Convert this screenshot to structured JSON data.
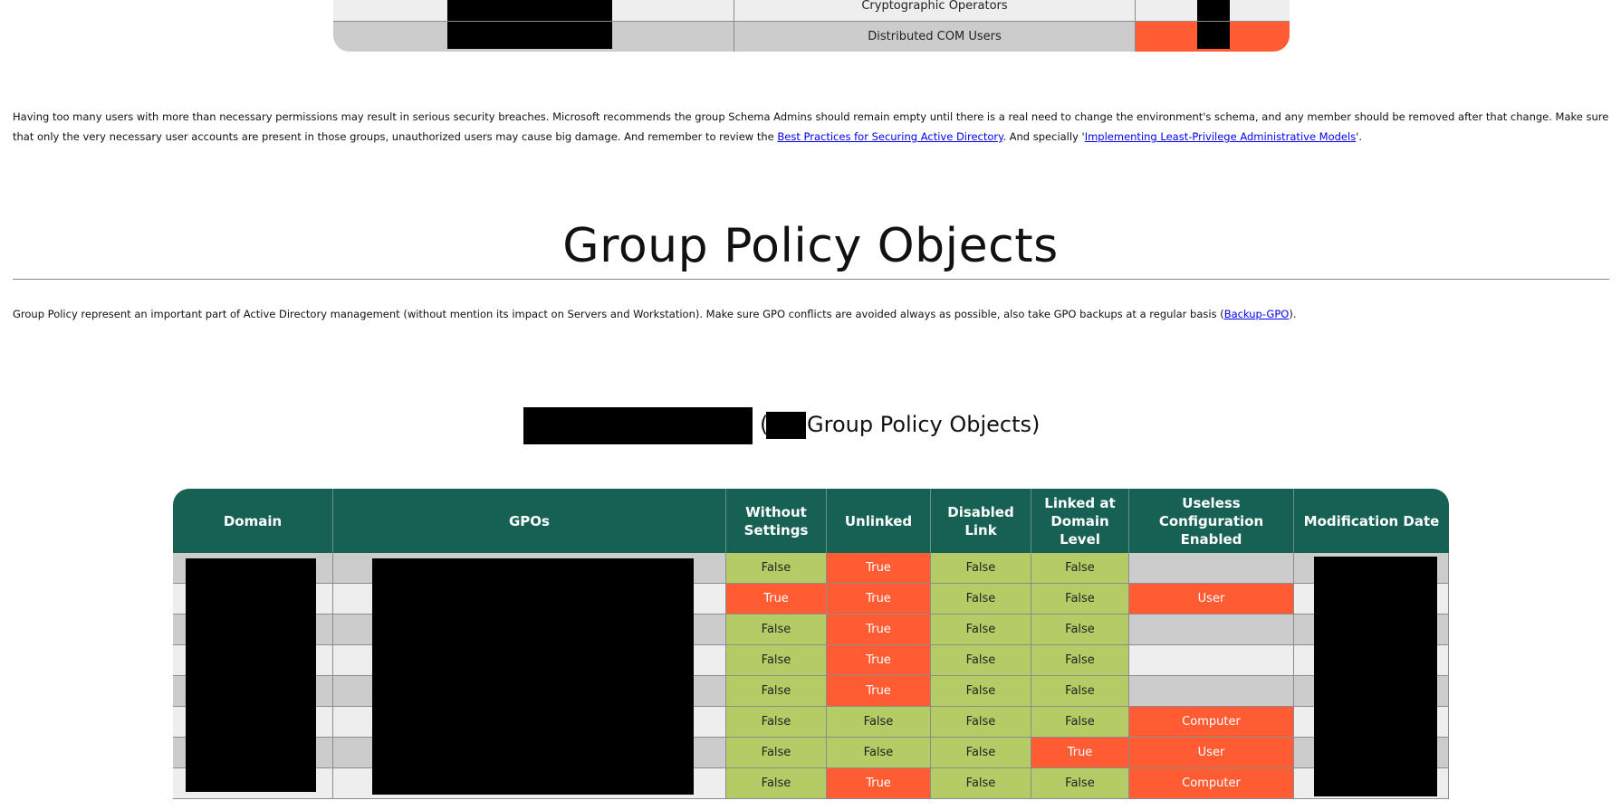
{
  "top_table": {
    "rows": [
      {
        "group": "Cryptographic Operators",
        "status_color": "#eeeeee",
        "row_color": "#eeeeee"
      },
      {
        "group": "Distributed COM Users",
        "status_color": "#ff5c33",
        "row_color": "#cccccc"
      }
    ]
  },
  "warning_paragraph": {
    "text_1": "Having too many users with more than necessary permissions may result in serious security breaches. Microsoft recommends the group Schema Admins should remain empty until there is a real need to change the environment's schema, and any member should be removed after that change. Make sure that only the very necessary user accounts are present in those groups, unauthorized users may cause big damage. And remember to review the ",
    "link_1": "Best Practices for Securing Active Directory",
    "text_2": ". And specially '",
    "link_2": "Implementing Least-Privilege Administrative Models",
    "text_3": "'."
  },
  "gpo_section": {
    "title": "Group Policy Objects",
    "intro_text": "Group Policy represent an important part of Active Directory management (without mention its impact on Servers and Workstation). Make sure GPO conflicts are avoided always as possible, also take GPO backups at a regular basis (",
    "intro_link": "Backup-GPO",
    "intro_end": ").",
    "subheading_open": "(",
    "subheading_suffix": "Group Policy Objects)"
  },
  "gpo_table": {
    "headers": [
      "Domain",
      "GPOs",
      "Without Settings",
      "Unlinked",
      "Disabled Link",
      "Linked at Domain Level",
      "Useless Configuration Enabled",
      "Modification Date"
    ],
    "rows": [
      {
        "without": "False",
        "unlinked": "True",
        "disabled": "False",
        "linked_domain": "False",
        "useless": ""
      },
      {
        "without": "True",
        "unlinked": "True",
        "disabled": "False",
        "linked_domain": "False",
        "useless": "User"
      },
      {
        "without": "False",
        "unlinked": "True",
        "disabled": "False",
        "linked_domain": "False",
        "useless": ""
      },
      {
        "without": "False",
        "unlinked": "True",
        "disabled": "False",
        "linked_domain": "False",
        "useless": ""
      },
      {
        "without": "False",
        "unlinked": "True",
        "disabled": "False",
        "linked_domain": "False",
        "useless": ""
      },
      {
        "without": "False",
        "unlinked": "False",
        "disabled": "False",
        "linked_domain": "False",
        "useless": "Computer"
      },
      {
        "without": "False",
        "unlinked": "False",
        "disabled": "False",
        "linked_domain": "True",
        "useless": "User"
      },
      {
        "without": "False",
        "unlinked": "True",
        "disabled": "False",
        "linked_domain": "False",
        "useless": "Computer"
      }
    ]
  },
  "colors": {
    "header": "#176154",
    "ok": "#b5cc66",
    "bad": "#ff5c33",
    "stripe_dark": "#cccccc",
    "stripe_light": "#eeeeee"
  }
}
